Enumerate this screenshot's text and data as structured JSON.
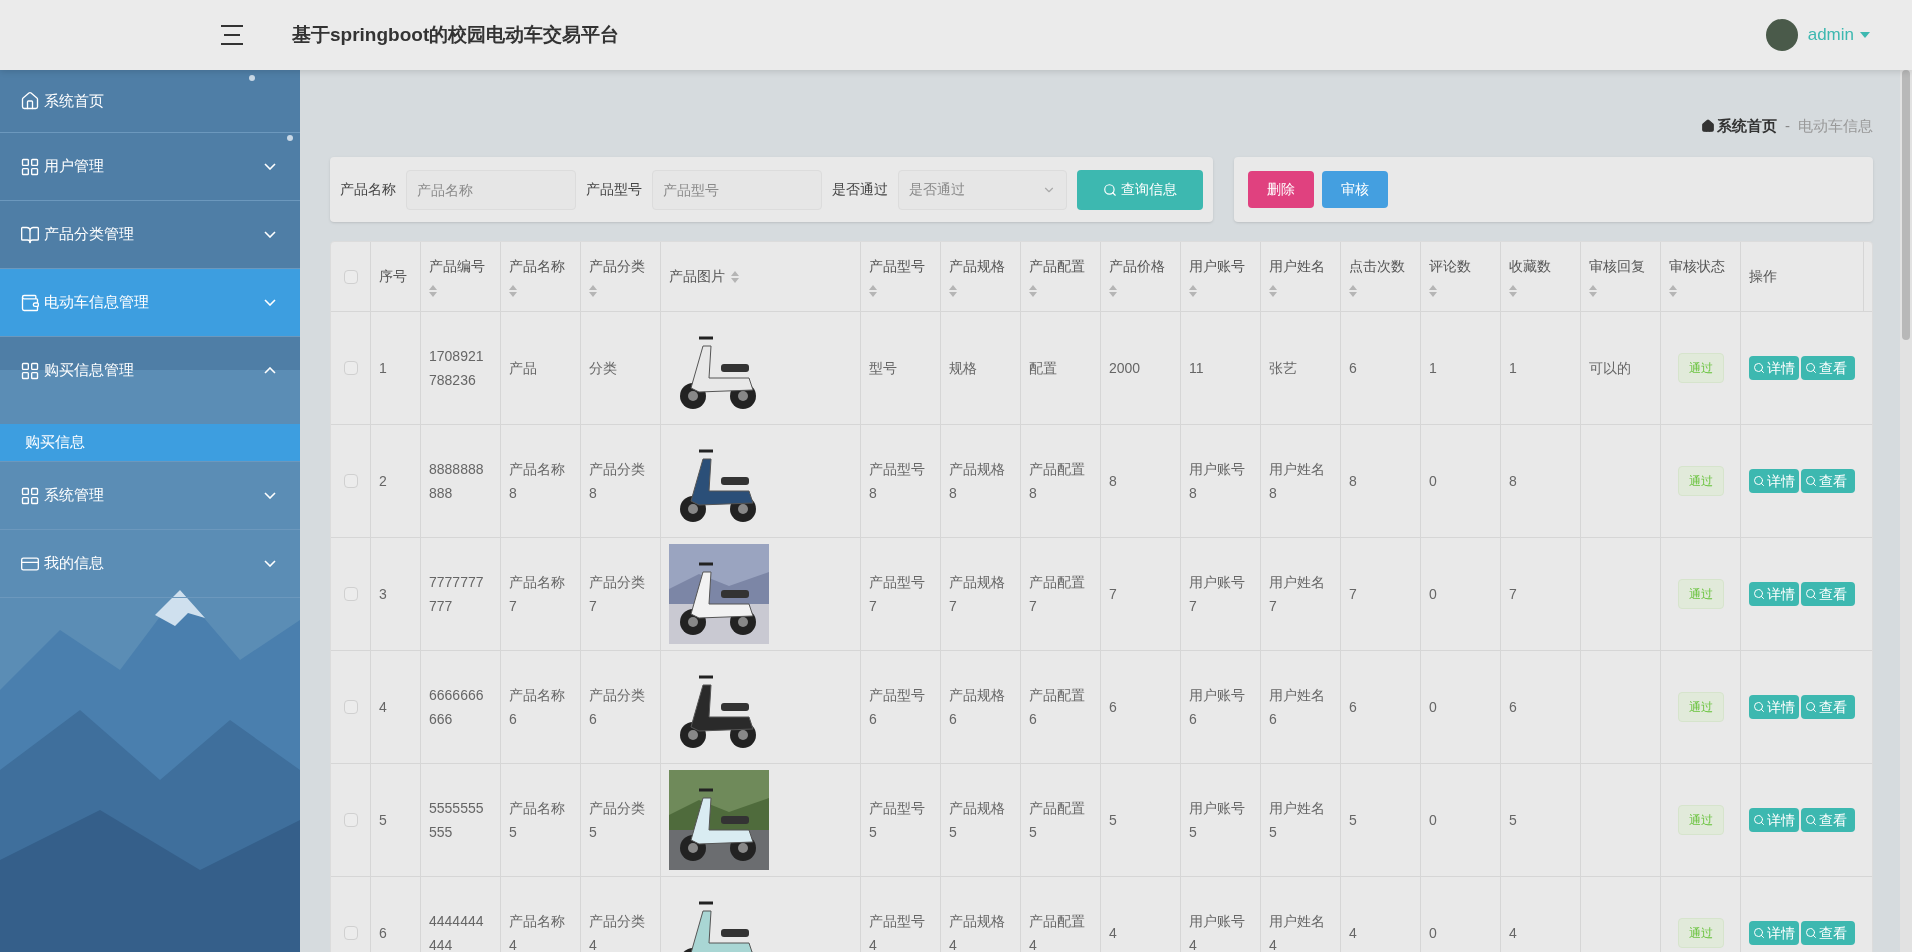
{
  "header": {
    "title": "基于springboot的校园电动车交易平台",
    "user": "admin"
  },
  "sidebar": {
    "items": [
      {
        "label": "系统首页",
        "selected": false
      },
      {
        "label": "用户管理",
        "selected": false,
        "expanded": false
      },
      {
        "label": "产品分类管理",
        "selected": false,
        "expanded": false
      },
      {
        "label": "电动车信息管理",
        "selected": true,
        "expanded": false
      },
      {
        "label": "购买信息管理",
        "selected": false,
        "expanded": true,
        "children": [
          {
            "label": "购买信息",
            "selected": true
          }
        ]
      },
      {
        "label": "系统管理",
        "selected": false,
        "expanded": false
      },
      {
        "label": "我的信息",
        "selected": false,
        "expanded": false
      }
    ]
  },
  "breadcrumb": {
    "items": [
      "系统首页",
      "电动车信息"
    ],
    "separator": "-"
  },
  "search": {
    "fields": [
      {
        "kind": "text",
        "label": "产品名称",
        "placeholder": "产品名称"
      },
      {
        "kind": "text",
        "label": "产品型号",
        "placeholder": "产品型号"
      },
      {
        "kind": "select",
        "label": "是否通过",
        "placeholder": "是否通过"
      }
    ],
    "button": "查询信息"
  },
  "actions": [
    {
      "kind": "danger",
      "label": "删除"
    },
    {
      "kind": "primary",
      "label": "审核"
    }
  ],
  "table": {
    "select_all": {
      "checked": false
    },
    "columns": [
      {
        "label": "序号",
        "sortable": false
      },
      {
        "label": "产品编号",
        "sortable": true
      },
      {
        "label": "产品名称",
        "sortable": true
      },
      {
        "label": "产品分类",
        "sortable": true
      },
      {
        "label": "产品图片",
        "sortable": true
      },
      {
        "label": "产品型号",
        "sortable": true
      },
      {
        "label": "产品规格",
        "sortable": true
      },
      {
        "label": "产品配置",
        "sortable": true
      },
      {
        "label": "产品价格",
        "sortable": true
      },
      {
        "label": "用户账号",
        "sortable": true
      },
      {
        "label": "用户姓名",
        "sortable": true
      },
      {
        "label": "点击次数",
        "sortable": true
      },
      {
        "label": "评论数",
        "sortable": true
      },
      {
        "label": "收藏数",
        "sortable": true
      },
      {
        "label": "审核回复",
        "sortable": true
      },
      {
        "label": "审核状态",
        "sortable": true
      },
      {
        "label": "操作",
        "sortable": false
      }
    ],
    "rows": [
      {
        "checked": false,
        "cells": [
          "1",
          "1708921788236",
          "产品",
          "分类",
          {
            "kind": "picture"
          },
          "型号",
          "规格",
          "配置",
          "2000",
          "11",
          "张艺",
          "6",
          "1",
          "1",
          "可以的",
          {
            "kind": "pass",
            "label": "通过"
          },
          [
            "详情",
            "查看"
          ]
        ]
      },
      {
        "checked": false,
        "cells": [
          "2",
          "8888888888",
          "产品名称8",
          "产品分类8",
          {
            "kind": "picture"
          },
          "产品型号8",
          "产品规格8",
          "产品配置8",
          "8",
          "用户账号8",
          "用户姓名8",
          "8",
          "0",
          "8",
          "",
          {
            "kind": "pass",
            "label": "通过"
          },
          [
            "详情",
            "查看"
          ]
        ]
      },
      {
        "checked": false,
        "cells": [
          "3",
          "7777777777",
          "产品名称7",
          "产品分类7",
          {
            "kind": "picture"
          },
          "产品型号7",
          "产品规格7",
          "产品配置7",
          "7",
          "用户账号7",
          "用户姓名7",
          "7",
          "0",
          "7",
          "",
          {
            "kind": "pass",
            "label": "通过"
          },
          [
            "详情",
            "查看"
          ]
        ]
      },
      {
        "checked": false,
        "cells": [
          "4",
          "6666666666",
          "产品名称6",
          "产品分类6",
          {
            "kind": "picture"
          },
          "产品型号6",
          "产品规格6",
          "产品配置6",
          "6",
          "用户账号6",
          "用户姓名6",
          "6",
          "0",
          "6",
          "",
          {
            "kind": "pass",
            "label": "通过"
          },
          [
            "详情",
            "查看"
          ]
        ]
      },
      {
        "checked": false,
        "cells": [
          "5",
          "5555555555",
          "产品名称5",
          "产品分类5",
          {
            "kind": "picture"
          },
          "产品型号5",
          "产品规格5",
          "产品配置5",
          "5",
          "用户账号5",
          "用户姓名5",
          "5",
          "0",
          "5",
          "",
          {
            "kind": "pass",
            "label": "通过"
          },
          [
            "详情",
            "查看"
          ]
        ]
      },
      {
        "checked": false,
        "cells": [
          "6",
          "4444444444",
          "产品名称4",
          "产品分类4",
          {
            "kind": "picture"
          },
          "产品型号4",
          "产品规格4",
          "产品配置4",
          "4",
          "用户账号4",
          "用户姓名4",
          "4",
          "0",
          "4",
          "",
          {
            "kind": "pass",
            "label": "通过"
          },
          [
            "详情",
            "查看"
          ]
        ]
      }
    ]
  }
}
